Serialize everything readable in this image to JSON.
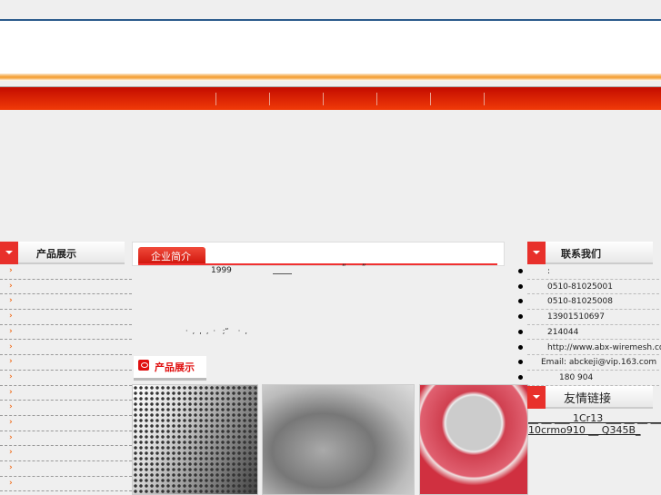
{
  "nav": {
    "items": [
      "",
      "",
      "",
      "",
      "",
      "",
      ""
    ]
  },
  "left_sidebar": {
    "title": "产品展示",
    "arrow": "›",
    "item_count": 15
  },
  "about": {
    "tab": "企业简介",
    "year": "1999",
    "quote_marks": "“      ”",
    "punct": "·  ,  ,  ,  ·   ;“    ·  ,"
  },
  "products": {
    "title": "产品展示",
    "images": [
      "perforated-metal-sheet",
      "stainless-mesh-tubes",
      "filter-mesh-discs"
    ]
  },
  "contact": {
    "title": "联系我们",
    "items": [
      ":",
      "0510-81025001",
      "0510-81025008",
      "13901510697",
      "214044",
      "http://www.abx-wiremesh.com",
      "Email: abckeji@vip.163.com",
      "180     904"
    ]
  },
  "links": {
    "title": "友情链接",
    "lines": [
      "__ __ ___ 1Cr13 ___ __ __ ___",
      "10crmo910 __ Q345B_"
    ]
  },
  "colors": {
    "accent": "#e8302b",
    "nav": "#d8200a",
    "orange": "#f5a540"
  }
}
